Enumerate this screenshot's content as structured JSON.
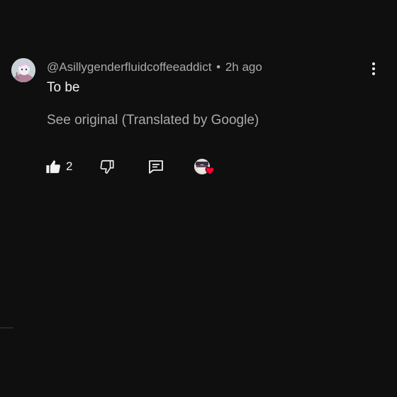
{
  "comment": {
    "author_handle": "@Asillygenderfluidcoffeeaddict",
    "separator": "•",
    "time_ago": "2h ago",
    "body": "To be",
    "translation_link": "See original (Translated by Google)",
    "like_count": "2",
    "avatar_icon": "user-avatar",
    "menu_icon": "more-vert-icon"
  },
  "actions": {
    "like_icon": "thumb-up-icon",
    "dislike_icon": "thumb-down-icon",
    "reply_icon": "comment-icon",
    "creator_heart_icon": "creator-heart-icon"
  },
  "colors": {
    "background": "#0f0f0f",
    "primary_text": "#f1f1f1",
    "secondary_text": "#aaaaaa",
    "heart": "#ff0033"
  }
}
